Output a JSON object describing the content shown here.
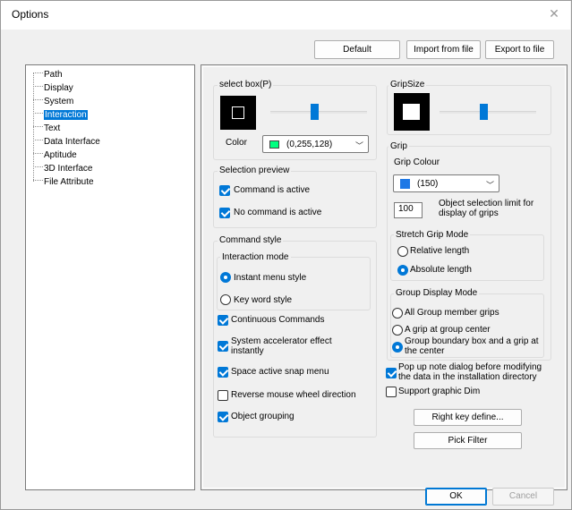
{
  "window": {
    "title": "Options",
    "close_glyph": "✕"
  },
  "toolbar": {
    "default_label": "Default",
    "import_label": "Import from file",
    "export_label": "Export to file"
  },
  "tree": {
    "items": [
      {
        "label": "Path"
      },
      {
        "label": "Display"
      },
      {
        "label": "System"
      },
      {
        "label": "Interaction"
      },
      {
        "label": "Text"
      },
      {
        "label": "Data Interface"
      },
      {
        "label": "Aptitude"
      },
      {
        "label": "3D Interface"
      },
      {
        "label": "File Attribute"
      }
    ],
    "selected": "Interaction"
  },
  "select_box": {
    "title": "select box(P)",
    "size_level": 0.45,
    "color_label": "Color",
    "color_value": "(0,255,128)",
    "color_swatch": "#00ff80"
  },
  "grip_size": {
    "title": "GripSize",
    "size_level": 0.45
  },
  "grip": {
    "title": "Grip",
    "colour_label": "Grip Colour",
    "colour_value": "(150)",
    "colour_swatch": "#1e78e6",
    "limit_value": "100",
    "limit_label": "Object selection limit for display of grips",
    "stretch": {
      "title": "Stretch Grip Mode",
      "options": [
        "Relative length",
        "Absolute length"
      ],
      "selected": "Absolute length"
    },
    "group_display": {
      "title": "Group Display Mode",
      "options": [
        "All Group member grips",
        "A grip at group center",
        "Group boundary box and a grip at the center"
      ],
      "selected": "Group boundary box and a grip at the center"
    }
  },
  "selection_preview": {
    "title": "Selection preview",
    "command_active": "Command is active",
    "no_command_active": "No command is active"
  },
  "command_style": {
    "title": "Command style",
    "interaction_mode": {
      "title": "Interaction mode",
      "instant_menu": "Instant menu style",
      "key_word": "Key word style",
      "selected": "Instant menu style"
    },
    "continuous": "Continuous Commands",
    "accelerator": "System accelerator effect instantly",
    "snap_menu": "Space active snap menu",
    "reverse_wheel": "Reverse mouse wheel direction",
    "object_grouping": "Object grouping"
  },
  "right_col": {
    "popup_note": "Pop up note dialog before modifying the data in the installation directory",
    "support_dim": "Support graphic Dim",
    "right_key_label": "Right key define...",
    "pick_filter_label": "Pick Filter"
  },
  "footer": {
    "ok_label": "OK",
    "cancel_label": "Cancel"
  },
  "colors": {
    "accent": "#0078d7",
    "window_bg": "#f0f0f0"
  }
}
